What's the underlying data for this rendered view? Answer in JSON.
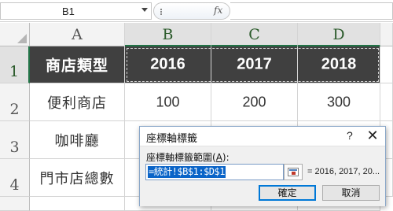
{
  "formula_bar": {
    "name_box": "B1",
    "fx_label": "fx",
    "formula": ""
  },
  "columns": [
    "A",
    "B",
    "C",
    "D"
  ],
  "rows": [
    "1",
    "2",
    "3",
    "4"
  ],
  "cells": {
    "A1": "商店類型",
    "B1": "2016",
    "C1": "2017",
    "D1": "2018",
    "A2": "便利商店",
    "B2": "100",
    "C2": "200",
    "D2": "300",
    "A3": "咖啡廳",
    "A4": "門市店總數"
  },
  "dialog": {
    "title": "座標軸標籤",
    "help": "?",
    "close": "✕",
    "range_label": "座標軸標籤範圍(",
    "range_label_key": "A",
    "range_label_end": "):",
    "range_value": "=統計!$B$1:$D$1",
    "preview": "= 2016, 2017, 20...",
    "ok_label": "確定",
    "cancel_label": "取消"
  },
  "colors": {
    "header_fill": "#404040",
    "header_text": "#ffffff",
    "selection_accent": "#217346",
    "dialog_border": "#8aa7c8"
  }
}
